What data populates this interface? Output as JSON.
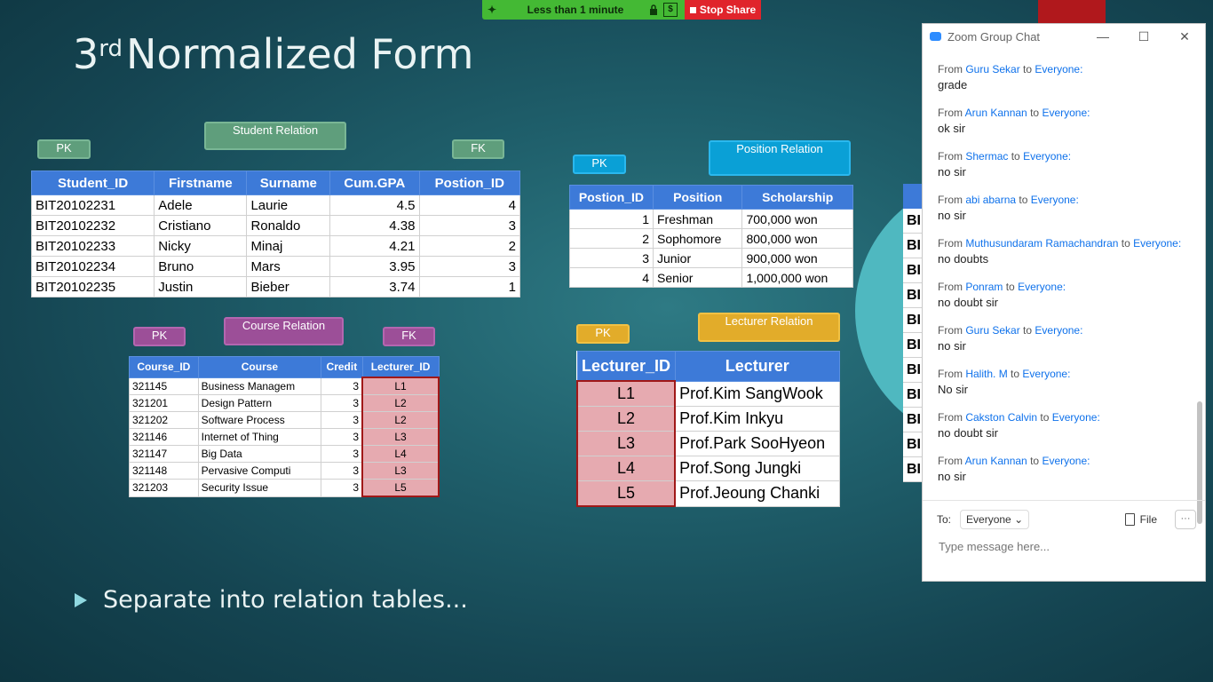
{
  "share_bar": {
    "timer": "Less than 1 minute",
    "stop_label": "Stop Share",
    "dollar": "$"
  },
  "slide": {
    "title_num": "3",
    "title_sup": "rd",
    "title_rest": "Normalized Form",
    "bullet": "Separate into relation tables..."
  },
  "labels": {
    "student_relation": "Student Relation",
    "position_relation": "Position Relation",
    "course_relation": "Course Relation",
    "lecturer_relation": "Lecturer Relation",
    "pk": "PK",
    "fk": "FK"
  },
  "student_table": {
    "headers": [
      "Student_ID",
      "Firstname",
      "Surname",
      "Cum.GPA",
      "Postion_ID"
    ],
    "rows": [
      [
        "BIT20102231",
        "Adele",
        "Laurie",
        "4.5",
        "4"
      ],
      [
        "BIT20102232",
        "Cristiano",
        "Ronaldo",
        "4.38",
        "3"
      ],
      [
        "BIT20102233",
        "Nicky",
        "Minaj",
        "4.21",
        "2"
      ],
      [
        "BIT20102234",
        "Bruno",
        "Mars",
        "3.95",
        "3"
      ],
      [
        "BIT20102235",
        "Justin",
        "Bieber",
        "3.74",
        "1"
      ]
    ]
  },
  "position_table": {
    "headers": [
      "Postion_ID",
      "Position",
      "Scholarship"
    ],
    "rows": [
      [
        "1",
        "Freshman",
        "700,000 won"
      ],
      [
        "2",
        "Sophomore",
        "800,000 won"
      ],
      [
        "3",
        "Junior",
        "900,000 won"
      ],
      [
        "4",
        "Senior",
        "1,000,000 won"
      ]
    ]
  },
  "course_table": {
    "headers": [
      "Course_ID",
      "Course",
      "Credit",
      "Lecturer_ID"
    ],
    "rows": [
      [
        "321145",
        "Business Managem",
        "3",
        "L1"
      ],
      [
        "321201",
        "Design Pattern",
        "3",
        "L2"
      ],
      [
        "321202",
        "Software Process",
        "3",
        "L2"
      ],
      [
        "321146",
        "Internet of Thing",
        "3",
        "L3"
      ],
      [
        "321147",
        "Big Data",
        "3",
        "L4"
      ],
      [
        "321148",
        "Pervasive Computi",
        "3",
        "L3"
      ],
      [
        "321203",
        "Security Issue",
        "3",
        "L5"
      ]
    ]
  },
  "lecturer_table": {
    "headers": [
      "Lecturer_ID",
      "Lecturer"
    ],
    "rows": [
      [
        "L1",
        "Prof.Kim SangWook"
      ],
      [
        "L2",
        "Prof.Kim Inkyu"
      ],
      [
        "L3",
        "Prof.Park SooHyeon"
      ],
      [
        "L4",
        "Prof.Song Jungki"
      ],
      [
        "L5",
        "Prof.Jeoung Chanki"
      ]
    ]
  },
  "partial_table": {
    "cells": [
      "BI",
      "BI",
      "BI",
      "BI",
      "BI",
      "BI",
      "BI",
      "BI",
      "BI",
      "BI",
      "BI"
    ]
  },
  "chat": {
    "title": "Zoom Group Chat",
    "from_word": "From",
    "to_word": "to",
    "messages": [
      {
        "sender": "Guru Sekar",
        "recipient": "Everyone:",
        "text": "grade"
      },
      {
        "sender": "Arun Kannan",
        "recipient": "Everyone:",
        "text": "ok sir"
      },
      {
        "sender": "Shermac",
        "recipient": "Everyone:",
        "text": "no sir"
      },
      {
        "sender": "abi abarna",
        "recipient": "Everyone:",
        "text": "no sir"
      },
      {
        "sender": "Muthusundaram Ramachandran",
        "recipient": "Everyone:",
        "text": "no doubts"
      },
      {
        "sender": "Ponram",
        "recipient": "Everyone:",
        "text": "no doubt sir"
      },
      {
        "sender": "Guru Sekar",
        "recipient": "Everyone:",
        "text": "no sir"
      },
      {
        "sender": "Halith. M",
        "recipient": "Everyone:",
        "text": "No sir"
      },
      {
        "sender": "Cakston Calvin",
        "recipient": "Everyone:",
        "text": "no doubt sir"
      },
      {
        "sender": "Arun Kannan",
        "recipient": "Everyone:",
        "text": "no sir"
      }
    ],
    "to_label": "To:",
    "to_value": "Everyone",
    "file_label": "File",
    "more_label": "···",
    "input_placeholder": "Type message here..."
  }
}
